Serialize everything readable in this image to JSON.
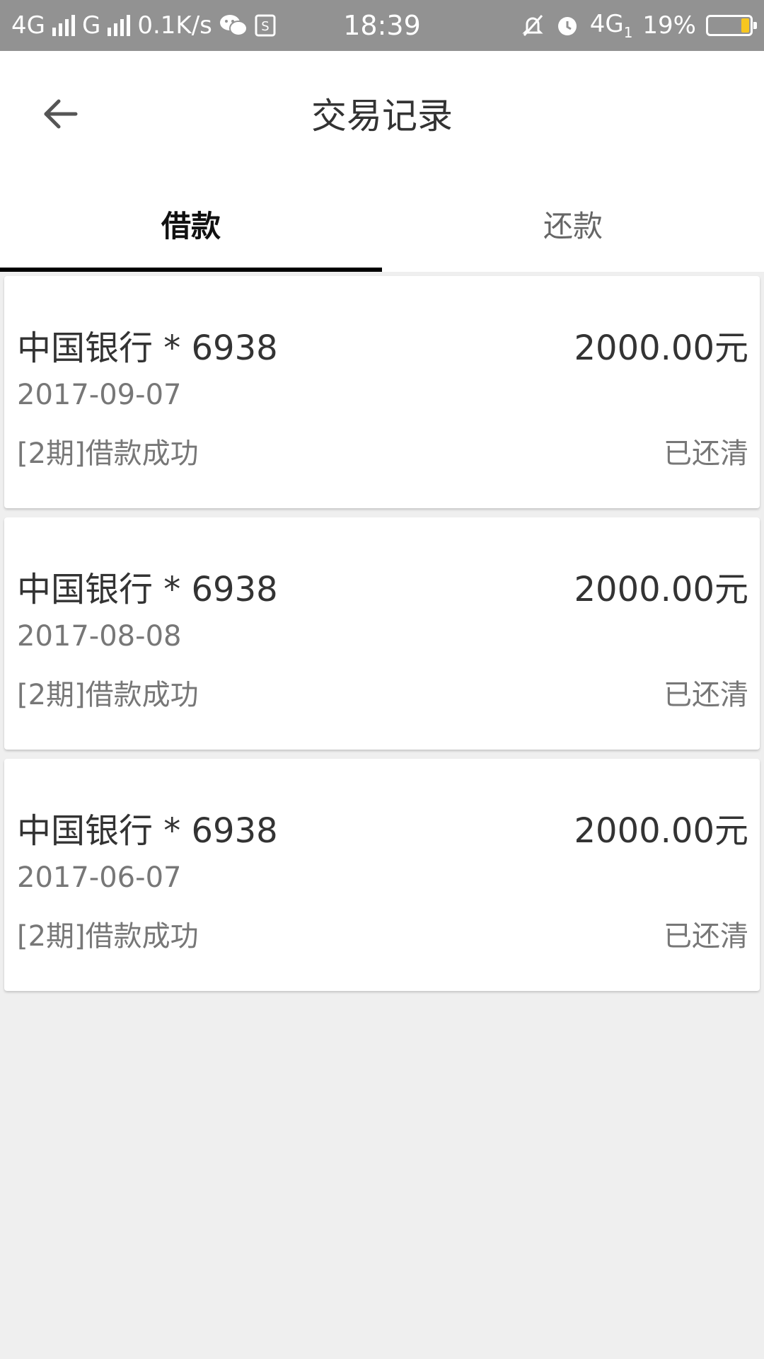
{
  "status_bar": {
    "network1": "4G",
    "network2": "G",
    "speed": "0.1K/s",
    "time": "18:39",
    "network3": "4G",
    "network3_sub": "1",
    "battery": "19%",
    "icons": [
      "wechat-icon",
      "sim-icon",
      "mute-icon",
      "alarm-icon",
      "battery-icon"
    ],
    "battery_color": "#f7c61f"
  },
  "header": {
    "title": "交易记录",
    "back_icon": "arrow-left-icon"
  },
  "tabs": [
    {
      "label": "借款",
      "active": true
    },
    {
      "label": "还款",
      "active": false
    }
  ],
  "records": [
    {
      "bank": "中国银行 * 6938",
      "amount": "2000.00元",
      "date": "2017-09-07",
      "desc": "[2期]借款成功",
      "status": "已还清"
    },
    {
      "bank": "中国银行 * 6938",
      "amount": "2000.00元",
      "date": "2017-08-08",
      "desc": "[2期]借款成功",
      "status": "已还清"
    },
    {
      "bank": "中国银行 * 6938",
      "amount": "2000.00元",
      "date": "2017-06-07",
      "desc": "[2期]借款成功",
      "status": "已还清"
    }
  ]
}
